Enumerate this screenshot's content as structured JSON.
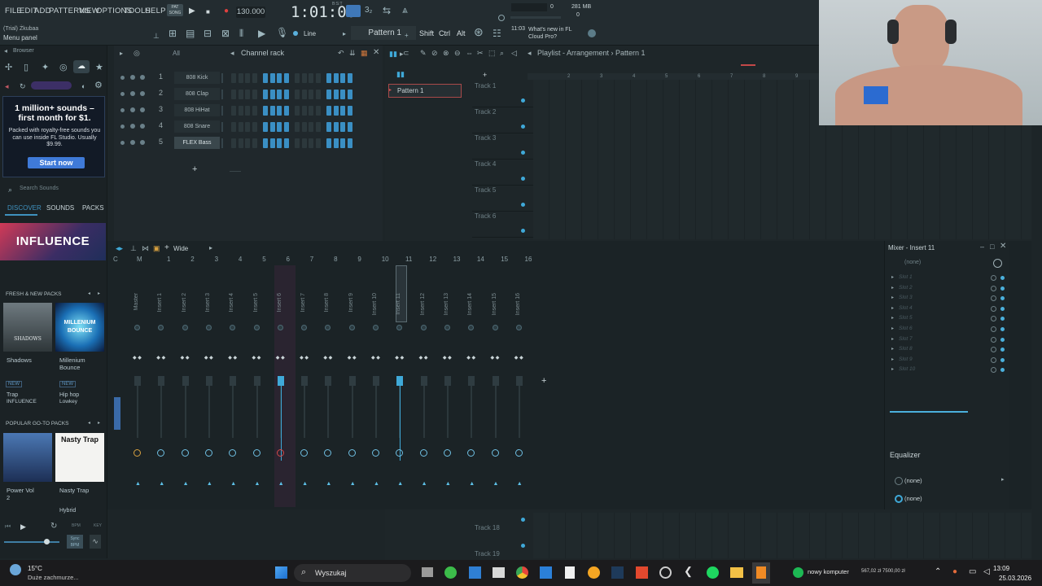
{
  "menu": {
    "items": [
      "FILE",
      "EDIT",
      "ADD",
      "PATTERNS",
      "VIEW",
      "OPTIONS",
      "TOOLS",
      "HELP"
    ],
    "trial_label": "(Trial) Żkubaa",
    "menu_panel": "Menu panel"
  },
  "transport": {
    "pat_song": "PAT SONG",
    "tempo": "130.000",
    "time": "1:01:00",
    "time_sub": "B:S:T",
    "cpu_label": "281 MB",
    "cpu_value": "0",
    "voices": "0",
    "pattern_label": "Pattern 1",
    "snap_label": "Line",
    "news_time": "11:03",
    "news_text": "What's new in FL Cloud Pro?",
    "mods": [
      "Shift",
      "Ctrl",
      "Alt"
    ]
  },
  "browser": {
    "title": "Browser",
    "ad": {
      "title": "1 million+ sounds – first month for $1.",
      "desc": "Packed with royalty-free sounds you can use inside FL Studio. Usually $9.99.",
      "button": "Start now"
    },
    "search_placeholder": "Search Sounds",
    "tabs": [
      "DISCOVER",
      "SOUNDS",
      "PACKS"
    ],
    "banner": "INFLUENCE",
    "fresh_header": "FRESH & NEW PACKS",
    "fresh_packs": [
      {
        "name": "Shadows",
        "badge": "NEW",
        "genre": "Trap",
        "artist": "INFLUENCE",
        "cover_text": "SHADOWS"
      },
      {
        "name": "Millenium Bounce",
        "badge": "NEW",
        "genre": "Hip hop",
        "artist": "Lowkey",
        "cover_text": "MILLENIUM BOUNCE"
      }
    ],
    "popular_header": "POPULAR GO-TO PACKS",
    "popular_packs": [
      {
        "name": "Power Vol 2"
      },
      {
        "name": "Nasty Trap",
        "cover_text": "Nasty Trap",
        "sub": "Hybrid"
      }
    ],
    "bpm_label": "BPM",
    "key_label": "KEY",
    "sync_label": "Sync BPM"
  },
  "channel_rack": {
    "title": "Channel rack",
    "filter": "All",
    "channels": [
      {
        "num": "1",
        "name": "808 Kick"
      },
      {
        "num": "2",
        "name": "808 Clap"
      },
      {
        "num": "3",
        "name": "808 HiHat"
      },
      {
        "num": "4",
        "name": "808 Snare"
      },
      {
        "num": "5",
        "name": "FLEX Bass"
      }
    ]
  },
  "pattern_list": {
    "items": [
      "Pattern 1"
    ]
  },
  "playlist": {
    "title": "Playlist - Arrangement › Pattern 1",
    "tracks": [
      "Track 1",
      "Track 2",
      "Track 3",
      "Track 4",
      "Track 5",
      "Track 6"
    ],
    "bottom_tracks": [
      "Track 18",
      "Track 19"
    ],
    "bars": [
      "2",
      "3",
      "4",
      "5",
      "6",
      "7",
      "8",
      "9"
    ]
  },
  "mixer": {
    "title": "Mixer - Insert 11",
    "view": "Wide",
    "track_numbers": [
      "C",
      "M",
      "1",
      "2",
      "3",
      "4",
      "5",
      "6",
      "7",
      "8",
      "9",
      "10",
      "11",
      "12",
      "13",
      "14",
      "15",
      "16"
    ],
    "insert_names": [
      "Master",
      "Insert 1",
      "Insert 2",
      "Insert 3",
      "Insert 4",
      "Insert 5",
      "Insert 6",
      "Insert 7",
      "Insert 8",
      "Insert 9",
      "Insert 10",
      "Insert 11",
      "Insert 12",
      "Insert 13",
      "Insert 14",
      "Insert 15",
      "Insert 16"
    ],
    "panel": {
      "input": "(none)",
      "slots": [
        "Slot 1",
        "Slot 2",
        "Slot 3",
        "Slot 4",
        "Slot 5",
        "Slot 6",
        "Slot 7",
        "Slot 8",
        "Slot 9",
        "Slot 10"
      ],
      "equalizer": "Equalizer",
      "out1": "(none)",
      "out2": "(none)"
    }
  },
  "taskbar": {
    "weather_temp": "15°C",
    "weather_desc": "Duże zachmurze...",
    "search": "Wyszukaj",
    "notif": "nowy komputer",
    "notif_val": "567,02 zł 7500,00 zł",
    "time": "13:09",
    "date": "25.03.2026"
  },
  "colors": {
    "accent": "#3fa9d8",
    "step_on": "#3a8fc4",
    "step_off": "#2c383c",
    "background": "#1d2528"
  }
}
